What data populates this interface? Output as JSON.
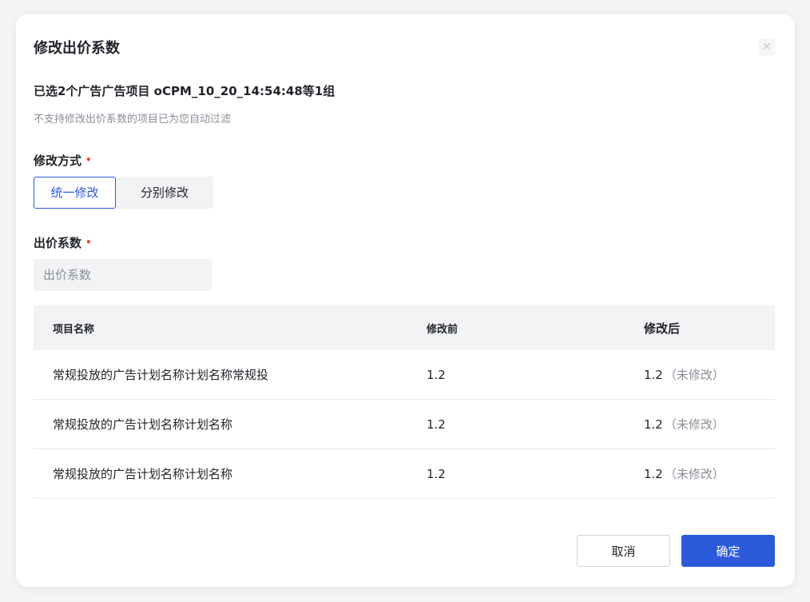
{
  "dialog": {
    "title": "修改出价系数",
    "close_icon": "close-icon",
    "selected_info": "已选2个广告广告项目 oCPM_10_20_14:54:48等1组",
    "filter_note": "不支持修改出价系数的项目已为您自动过滤",
    "mode": {
      "label": "修改方式",
      "required_mark": "•",
      "options": [
        "统一修改",
        "分别修改"
      ],
      "selected": "统一修改"
    },
    "coefficient": {
      "label": "出价系数",
      "required_mark": "•",
      "value": "",
      "placeholder": "出价系数"
    },
    "table": {
      "headers": [
        "项目名称",
        "修改前",
        "修改后"
      ],
      "rows": [
        {
          "name": "常规投放的广告计划名称计划名称常规投",
          "before": "1.2",
          "after": "1.2",
          "after_note": "（未修改）"
        },
        {
          "name": "常规投放的广告计划名称计划名称",
          "before": "1.2",
          "after": "1.2",
          "after_note": "（未修改）"
        },
        {
          "name": "常规投放的广告计划名称计划名称",
          "before": "1.2",
          "after": "1.2",
          "after_note": "（未修改）"
        }
      ]
    },
    "buttons": {
      "cancel": "取消",
      "confirm": "确定"
    },
    "colors": {
      "primary": "#2b5bdb",
      "required": "#f04438",
      "muted": "#8a8f99"
    }
  }
}
